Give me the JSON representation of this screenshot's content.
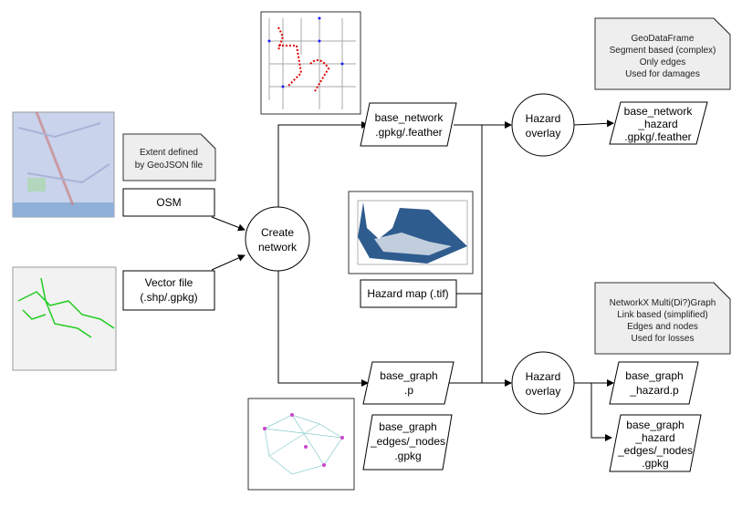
{
  "inputs": {
    "extent_note": [
      "Extent defined",
      "by GeoJSON file"
    ],
    "osm": "OSM",
    "vector_file": [
      "Vector file",
      "(.shp/.gpkg)"
    ]
  },
  "create_network": [
    "Create",
    "network"
  ],
  "outputs": {
    "base_network": [
      "base_network",
      ".gpkg/.feather"
    ],
    "base_graph": [
      "base_graph",
      ".p"
    ],
    "base_graph_edges": [
      "base_graph",
      "_edges/_nodes",
      ".gpkg"
    ]
  },
  "hazard_map": "Hazard map (.tif)",
  "hazard_overlay": [
    "Hazard",
    "overlay"
  ],
  "results": {
    "base_network_hazard": [
      "base_network",
      "_hazard",
      ".gpkg/.feather"
    ],
    "base_graph_hazard": [
      "base_graph",
      "_hazard.p"
    ],
    "base_graph_hazard_edges": [
      "base_graph",
      "_hazard",
      "_edges/_nodes",
      ".gpkg"
    ]
  },
  "notes": {
    "geodataframe": [
      "GeoDataFrame",
      "Segment based (complex)",
      "Only edges",
      "Used for damages"
    ],
    "networkx": [
      "NetworkX Multi(Di?)Graph",
      "Link based (simplified)",
      "Edges and nodes",
      "Used for losses"
    ]
  },
  "colors": {
    "note_fill": "#eeeeee",
    "line": "#000000",
    "hazard_blue": "#0b3f7a",
    "network_red": "#e00000",
    "network_blue": "#1a1aff",
    "graph_green": "#22cc22"
  }
}
